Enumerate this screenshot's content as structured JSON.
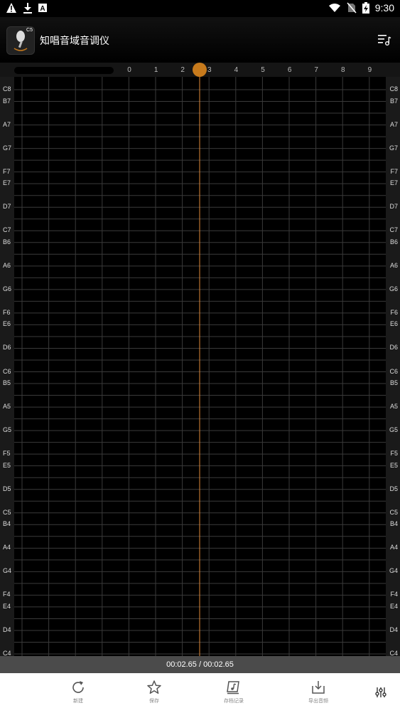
{
  "status_bar": {
    "time": "9:30",
    "left_icons": [
      "warning-icon",
      "download-icon",
      "text-a-icon"
    ],
    "right_icons": [
      "wifi-icon",
      "no-sim-icon",
      "battery-charging-icon"
    ]
  },
  "app_bar": {
    "title": "知唱音域音调仪",
    "logo_note": "C5",
    "logo_icon": "microphone-icon",
    "menu_icon": "music-list-icon"
  },
  "timeline": {
    "ticks": [
      "0",
      "1",
      "2",
      "3",
      "4",
      "5",
      "6",
      "7",
      "8",
      "9"
    ],
    "playhead_position_seconds": 2.65
  },
  "pitch_labels": [
    "C8",
    "B7",
    "A7",
    "G7",
    "F7",
    "E7",
    "D7",
    "C7",
    "B6",
    "A6",
    "G6",
    "F6",
    "E6",
    "D6",
    "C6",
    "B5",
    "A5",
    "G5",
    "F5",
    "E5",
    "D5",
    "C5",
    "B4",
    "A4",
    "G4",
    "F4",
    "E4",
    "D4",
    "C4"
  ],
  "time_display": "00:02.65 / 00:02.65",
  "bottom_nav": {
    "items": [
      {
        "label": "新建",
        "icon": "refresh-icon"
      },
      {
        "label": "保存",
        "icon": "star-icon"
      },
      {
        "label": "存档记录",
        "icon": "music-note-book-icon"
      },
      {
        "label": "导出音频",
        "icon": "download-box-icon"
      }
    ],
    "settings_icon": "sliders-icon"
  },
  "colors": {
    "accent": "#c77a1c",
    "playhead_line": "#e08a3a",
    "grid_line": "#3a3a3a",
    "background": "#000000"
  }
}
